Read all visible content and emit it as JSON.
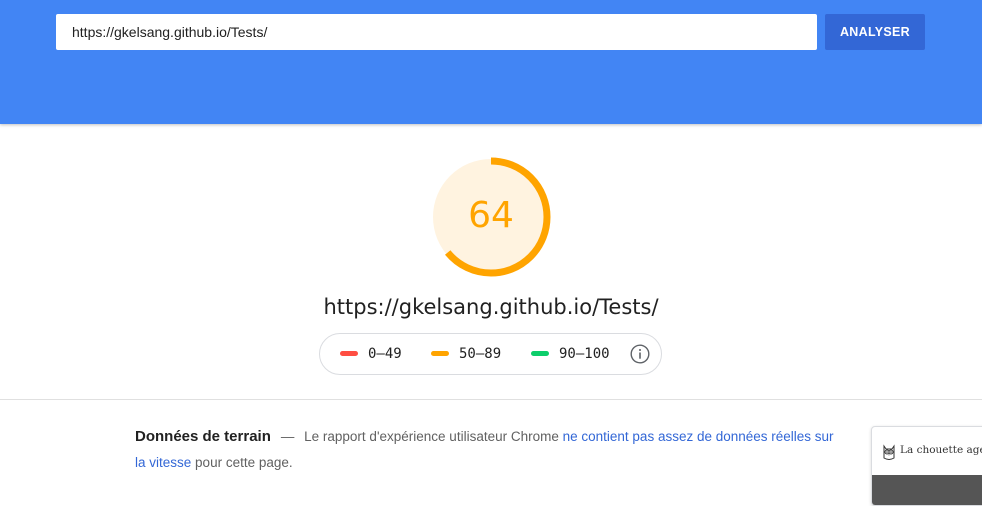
{
  "search": {
    "url_value": "https://gkelsang.github.io/Tests/",
    "analyze_label": "ANALYSER"
  },
  "score": {
    "value": "64",
    "fraction": 0.64,
    "color": "#ffa400",
    "fill_color": "#fff3e0"
  },
  "result_url": "https://gkelsang.github.io/Tests/",
  "legend": {
    "items": [
      {
        "label": "0–49",
        "color": "#ff4e42"
      },
      {
        "label": "50–89",
        "color": "#ffa400"
      },
      {
        "label": "90–100",
        "color": "#0cce6b"
      }
    ],
    "info_icon": "info-icon"
  },
  "field_data": {
    "title": "Données de terrain",
    "dash": "—",
    "text_before": "Le rapport d'expérience utilisateur Chrome",
    "link_text": "ne contient pas assez de données réelles sur la vitesse",
    "text_after": "pour cette page."
  },
  "thumbnail": {
    "title": "La chouette agence",
    "icon": "owl-icon"
  },
  "colors": {
    "header_bg": "#4285f4",
    "button_bg": "#3367d6",
    "link": "#3367d6"
  }
}
